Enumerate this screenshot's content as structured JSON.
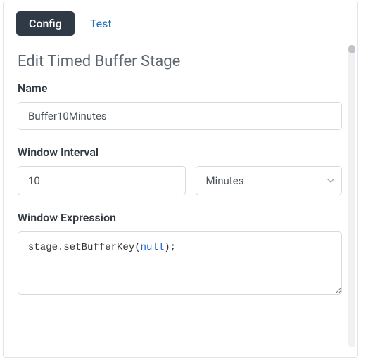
{
  "tabs": {
    "config": "Config",
    "test": "Test"
  },
  "title": "Edit Timed Buffer Stage",
  "fields": {
    "name": {
      "label": "Name",
      "value": "Buffer10Minutes"
    },
    "interval": {
      "label": "Window Interval",
      "value": "10",
      "unit_selected": "Minutes"
    },
    "expression": {
      "label": "Window Expression",
      "prefix": "stage.setBufferKey(",
      "null": "null",
      "suffix": ");"
    }
  }
}
